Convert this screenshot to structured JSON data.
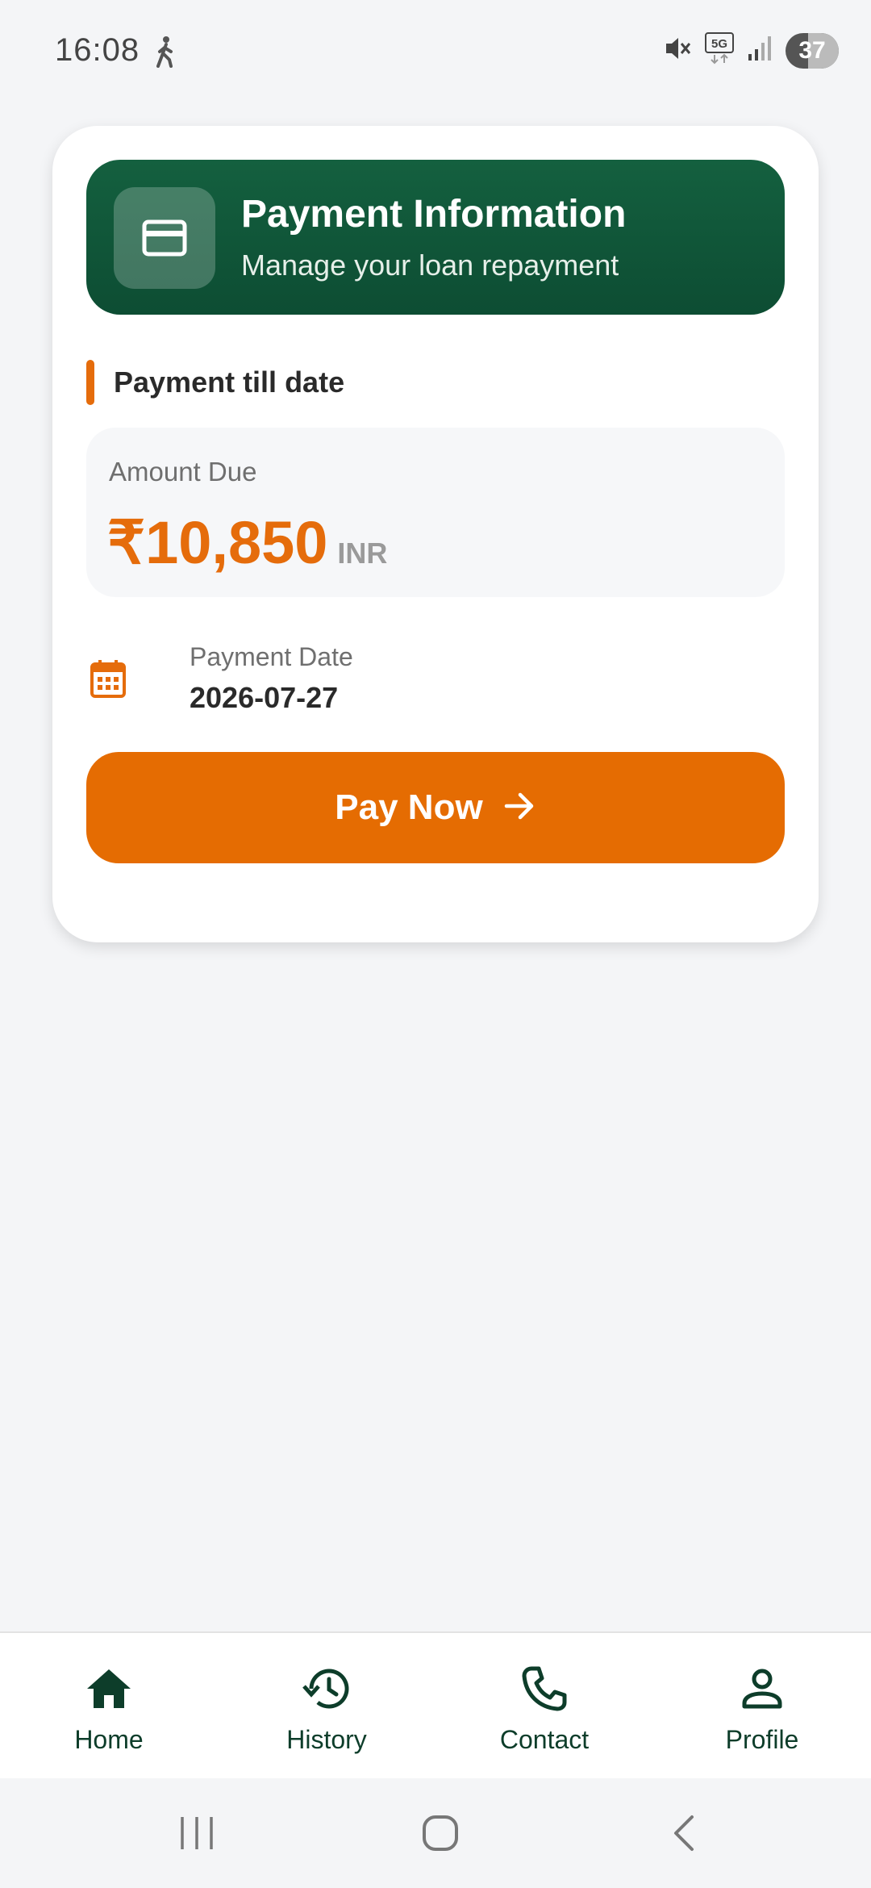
{
  "status_bar": {
    "time": "16:08",
    "battery": "37",
    "icons": [
      "walking-icon",
      "mute-icon",
      "5g-icon",
      "signal-icon",
      "battery-icon"
    ]
  },
  "header": {
    "title": "Payment Information",
    "subtitle": "Manage your loan repayment",
    "icon": "credit-card-icon"
  },
  "section": {
    "title": "Payment till date"
  },
  "amount": {
    "label": "Amount Due",
    "value": "₹10,850",
    "currency": "INR"
  },
  "payment_date": {
    "label": "Payment Date",
    "value": "2026-07-27",
    "icon": "calendar-icon"
  },
  "pay_button": {
    "label": "Pay Now",
    "icon": "arrow-right-icon"
  },
  "bottom_nav": {
    "items": [
      {
        "label": "Home",
        "icon": "home-icon"
      },
      {
        "label": "History",
        "icon": "history-icon"
      },
      {
        "label": "Contact",
        "icon": "phone-icon"
      },
      {
        "label": "Profile",
        "icon": "profile-icon"
      }
    ]
  },
  "system_nav": [
    "recents-icon",
    "home-circle-icon",
    "back-icon"
  ],
  "colors": {
    "brand_green": "#0f5539",
    "accent_orange": "#e56c02",
    "background": "#f4f5f7"
  }
}
